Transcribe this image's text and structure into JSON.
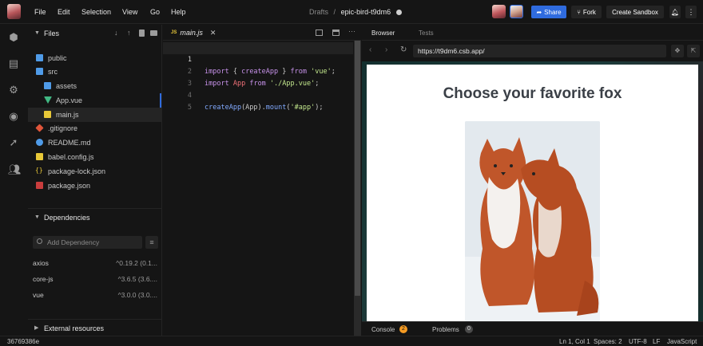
{
  "menu": [
    "File",
    "Edit",
    "Selection",
    "View",
    "Go",
    "Help"
  ],
  "breadcrumb": {
    "folder": "Drafts",
    "sep": "/",
    "name": "epic-bird-t9dm6"
  },
  "header_buttons": {
    "share": "Share",
    "fork": "Fork",
    "create": "Create Sandbox"
  },
  "sidebar": {
    "files_title": "Files",
    "tree": [
      {
        "name": "public",
        "icon": "folder-icon"
      },
      {
        "name": "src",
        "icon": "folder-icon"
      },
      {
        "name": "assets",
        "icon": "folder-icon"
      },
      {
        "name": "App.vue",
        "icon": "vue-file-icon"
      },
      {
        "name": "main.js",
        "icon": "js-file-icon"
      },
      {
        "name": ".gitignore",
        "icon": "git-file-icon"
      },
      {
        "name": "README.md",
        "icon": "info-file-icon"
      },
      {
        "name": "babel.config.js",
        "icon": "js-file-icon"
      },
      {
        "name": "package-lock.json",
        "icon": "json-file-icon"
      },
      {
        "name": "package.json",
        "icon": "npm-file-icon"
      }
    ],
    "deps_title": "Dependencies",
    "dep_placeholder": "Add Dependency",
    "deps": [
      {
        "name": "axios",
        "version": "^0.19.2 (0.1..."
      },
      {
        "name": "core-js",
        "version": "^3.6.5 (3.6...."
      },
      {
        "name": "vue",
        "version": "^3.0.0 (3.0...."
      }
    ],
    "external_title": "External resources"
  },
  "editor": {
    "tab_badge": "JS",
    "tab_name": "main.js",
    "line_numbers": [
      "1",
      "2",
      "3",
      "4",
      "5"
    ]
  },
  "preview": {
    "tabs": [
      "Browser",
      "Tests"
    ],
    "url": "https://t9dm6.csb.app/",
    "page_title": "Choose your favorite fox",
    "console_label": "Console",
    "console_count": "2",
    "problems_label": "Problems",
    "problems_count": "0"
  },
  "status": {
    "hash": "36769386e",
    "position": "Ln 1, Col 1",
    "spaces": "Spaces: 2",
    "encoding": "UTF-8",
    "eol": "LF",
    "language": "JavaScript"
  },
  "colors": {
    "accent": "#2f6bde",
    "console_badge": "#f59b23"
  }
}
